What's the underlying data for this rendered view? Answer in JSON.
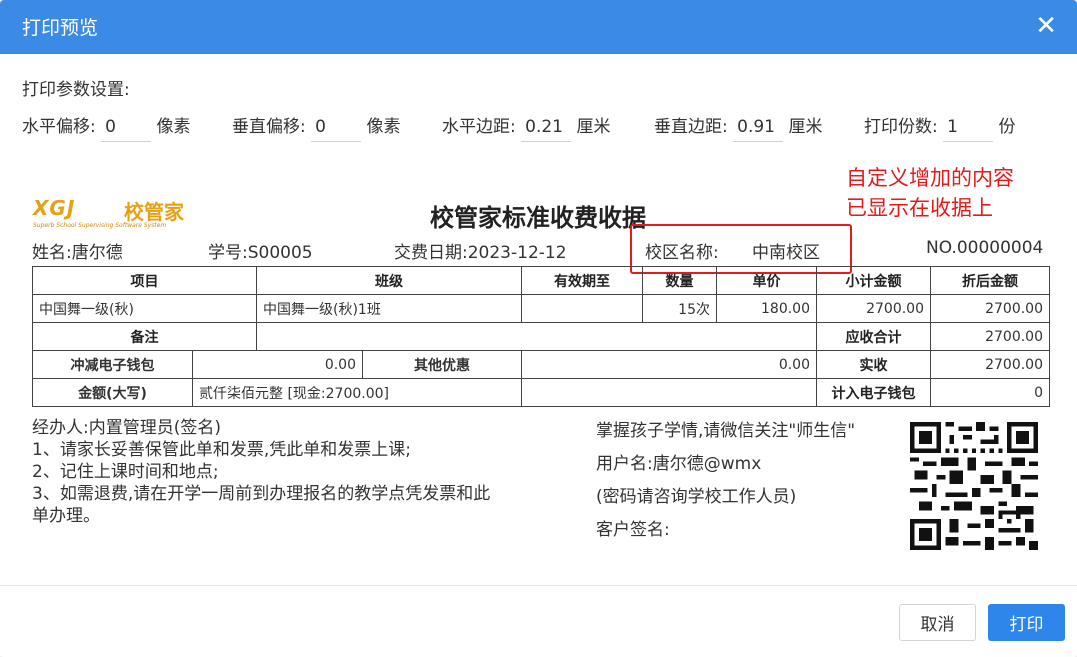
{
  "dialog": {
    "title": "打印预览",
    "close_icon": "close-icon"
  },
  "settings": {
    "label": "打印参数设置:",
    "params": [
      {
        "label": "水平偏移:",
        "value": "0",
        "unit": "像素"
      },
      {
        "label": "垂直偏移:",
        "value": "0",
        "unit": "像素"
      },
      {
        "label": "水平边距:",
        "value": "0.21",
        "unit": "厘米"
      },
      {
        "label": "垂直边距:",
        "value": "0.91",
        "unit": "厘米"
      },
      {
        "label": "打印份数:",
        "value": "1",
        "unit": "份"
      }
    ]
  },
  "receipt": {
    "logo": {
      "mark": "XGJ",
      "name": "校管家",
      "subtitle": "Superb School Supervising Software System"
    },
    "title": "校管家标准收费收据",
    "student_name": "姓名:唐尔德",
    "student_id": "学号:S00005",
    "pay_date": "交费日期:2023-12-12",
    "campus_label": "校区名称:",
    "campus_value": "中南校区",
    "receipt_no": "NO.00000004",
    "table": {
      "headers": [
        "项目",
        "班级",
        "有效期至",
        "数量",
        "单价",
        "小计金额",
        "折后金额"
      ],
      "row": [
        "中国舞一级(秋)",
        "中国舞一级(秋)1班",
        "",
        "15次",
        "180.00",
        "2700.00",
        "2700.00"
      ],
      "remark_label": "备注",
      "remark_value": "",
      "receivable_label": "应收合计",
      "receivable_value": "2700.00",
      "wallet_deduct_label": "冲减电子钱包",
      "wallet_deduct_value": "0.00",
      "other_discount_label": "其他优惠",
      "other_discount_value": "0.00",
      "actual_label": "实收",
      "actual_value": "2700.00",
      "amount_upper_label": "金额(大写)",
      "amount_upper_value": "贰仟柒佰元整 [现金:2700.00]",
      "wallet_in_label": "计入电子钱包",
      "wallet_in_value": "0"
    },
    "handler": "经办人:内置管理员(签名)",
    "notes": [
      "1、请家长妥善保管此单和发票,凭此单和发票上课;",
      "2、记住上课时间和地点;",
      "3、如需退费,请在开学一周前到办理报名的教学点凭发票和此单办理。"
    ],
    "wechat": {
      "line1": "掌握孩子学情,请微信关注\"师生信\"",
      "username": "用户名:唐尔德@wmx",
      "password_hint": "(密码请咨询学校工作人员)",
      "sign": "客户签名:"
    },
    "qr_icon": "qr-code-icon"
  },
  "annotation": {
    "line1": "自定义增加的内容",
    "line2": "已显示在收据上",
    "color": "#e31b1b"
  },
  "footer": {
    "cancel": "取消",
    "print": "打印"
  },
  "colors": {
    "header": "#3b8be6",
    "primary_button": "#2f86ea",
    "logo": "#e7a116"
  }
}
